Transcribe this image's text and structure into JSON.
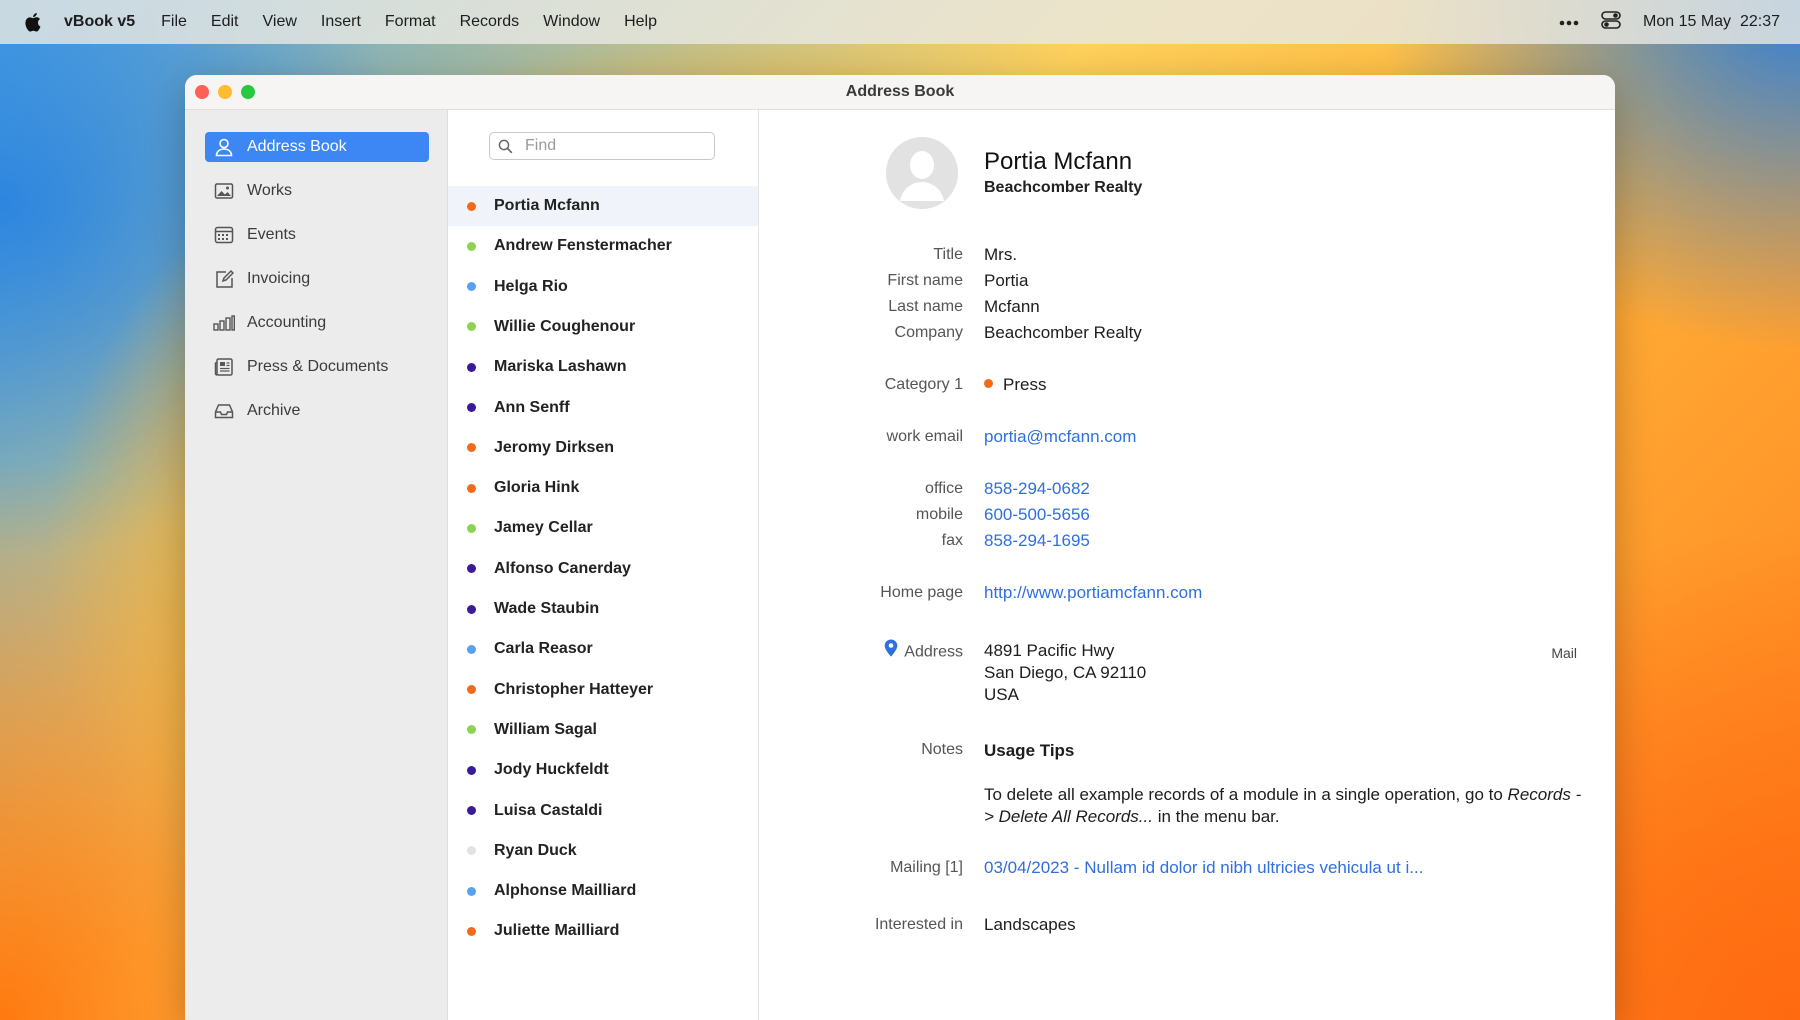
{
  "menubar": {
    "app_name": "vBook v5",
    "menus": [
      "File",
      "Edit",
      "View",
      "Insert",
      "Format",
      "Records",
      "Window",
      "Help"
    ],
    "date": "Mon 15 May",
    "time": "22:37"
  },
  "window": {
    "title": "Address Book"
  },
  "sidebar": {
    "items": [
      {
        "label": "Address Book",
        "icon": "person-icon",
        "active": true
      },
      {
        "label": "Works",
        "icon": "image-icon"
      },
      {
        "label": "Events",
        "icon": "calendar-icon"
      },
      {
        "label": "Invoicing",
        "icon": "edit-icon"
      },
      {
        "label": "Accounting",
        "icon": "bar-chart-icon"
      },
      {
        "label": "Press & Documents",
        "icon": "newspaper-icon"
      },
      {
        "label": "Archive",
        "icon": "tray-icon"
      }
    ]
  },
  "search": {
    "placeholder": "Find"
  },
  "contacts": [
    {
      "name": "Portia Mcfann",
      "color": "#f06a1a"
    },
    {
      "name": "Andrew Fenstermacher",
      "color": "#8bd450"
    },
    {
      "name": "Helga Rio",
      "color": "#5aa0f0"
    },
    {
      "name": "Willie Coughenour",
      "color": "#8bd450"
    },
    {
      "name": "Mariska Lashawn",
      "color": "#3b1a9a"
    },
    {
      "name": "Ann Senff",
      "color": "#3b1a9a"
    },
    {
      "name": "Jeromy Dirksen",
      "color": "#f06a1a"
    },
    {
      "name": "Gloria Hink",
      "color": "#f06a1a"
    },
    {
      "name": "Jamey Cellar",
      "color": "#8bd450"
    },
    {
      "name": "Alfonso Canerday",
      "color": "#3b1a9a"
    },
    {
      "name": "Wade Staubin",
      "color": "#3b1a9a"
    },
    {
      "name": "Carla Reasor",
      "color": "#5aa0f0"
    },
    {
      "name": "Christopher Hatteyer",
      "color": "#f06a1a"
    },
    {
      "name": "William Sagal",
      "color": "#8bd450"
    },
    {
      "name": "Jody Huckfeldt",
      "color": "#3b1a9a"
    },
    {
      "name": "Luisa Castaldi",
      "color": "#3b1a9a"
    },
    {
      "name": "Ryan Duck",
      "color": "#e2e2e2"
    },
    {
      "name": "Alphonse Mailliard",
      "color": "#5aa0f0"
    },
    {
      "name": "Juliette Mailliard",
      "color": "#f06a1a"
    }
  ],
  "detail": {
    "name": "Portia Mcfann",
    "company": "Beachcomber Realty",
    "fields": {
      "title_label": "Title",
      "title": "Mrs.",
      "first_label": "First name",
      "first": "Portia",
      "last_label": "Last name",
      "last": "Mcfann",
      "company_label": "Company",
      "company": "Beachcomber Realty",
      "category_label": "Category 1",
      "category": "Press",
      "category_color": "#f06a1a",
      "email_label": "work email",
      "email": "portia@mcfann.com",
      "office_label": "office",
      "office": "858-294-0682",
      "mobile_label": "mobile",
      "mobile": "600-500-5656",
      "fax_label": "fax",
      "fax": "858-294-1695",
      "homepage_label": "Home page",
      "homepage": "http://www.portiamcfann.com",
      "address_label": "Address",
      "address_line1": "4891 Pacific Hwy",
      "address_line2": "San Diego, CA 92110",
      "address_line3": "USA",
      "mail_label": "Mail",
      "notes_label": "Notes",
      "notes_title": "Usage Tips",
      "notes_text_1": "To delete all example records of a module in a single operation, go to ",
      "notes_italic_1": "Records -",
      "notes_italic_2": "> Delete All Records...",
      "notes_text_2": " in the menu bar.",
      "mailing_label": "Mailing [1]",
      "mailing": "03/04/2023 - Nullam id dolor id nibh ultricies vehicula ut i...",
      "interested_label": "Interested in",
      "interested": "Landscapes"
    }
  }
}
